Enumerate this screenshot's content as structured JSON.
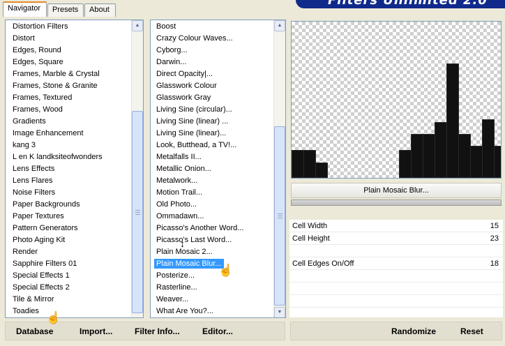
{
  "tabs": [
    "Navigator",
    "Presets",
    "About"
  ],
  "banner": "Filters Unlimited 2.0",
  "categories": [
    "Distortion Filters",
    "Distort",
    "Edges, Round",
    "Edges, Square",
    "Frames, Marble & Crystal",
    "Frames, Stone & Granite",
    "Frames, Textured",
    "Frames, Wood",
    "Gradients",
    "Image Enhancement",
    "kang 3",
    "L en K landksiteofwonders",
    "Lens Effects",
    "Lens Flares",
    "Noise Filters",
    "Paper Backgrounds",
    "Paper Textures",
    "Pattern Generators",
    "Photo Aging Kit",
    "Render",
    "Sapphire Filters 01",
    "Special Effects 1",
    "Special Effects 2",
    "Tile & Mirror",
    "Toadies"
  ],
  "filters": [
    "Boost",
    "Crazy Colour Waves...",
    "Cyborg...",
    "Darwin...",
    "Direct Opacity|...",
    "Glasswork Colour",
    "Glasswork Gray",
    "Living Sine (circular)...",
    "Living Sine (linear) ...",
    "Living Sine (linear)...",
    "Look, Butthead, a TV!...",
    "Metalfalls II...",
    "Metallic Onion...",
    "Metalwork...",
    "Motion Trail...",
    "Old Photo...",
    "Ommadawn...",
    "Picasso's Another Word...",
    "Picasso's Last Word...",
    "Plain Mosaic 2...",
    "Plain Mosaic Blur...",
    "Posterize...",
    "Rasterline...",
    "Weaver...",
    "What Are You?..."
  ],
  "selected_filter": "Plain Mosaic Blur...",
  "filter_name_button": "Plain Mosaic Blur...",
  "params": [
    {
      "label": "Cell Width",
      "value": "15"
    },
    {
      "label": "Cell Height",
      "value": "23"
    },
    {
      "label": "Cell Edges On/Off",
      "value": "18"
    }
  ],
  "buttons": {
    "database": "Database",
    "import": "Import...",
    "filter_info": "Filter Info...",
    "editor": "Editor...",
    "randomize": "Randomize",
    "reset": "Reset"
  },
  "icons": {
    "hand_cursor": "hand-pointer-icon",
    "resize_cursor": "vertical-resize-icon"
  }
}
